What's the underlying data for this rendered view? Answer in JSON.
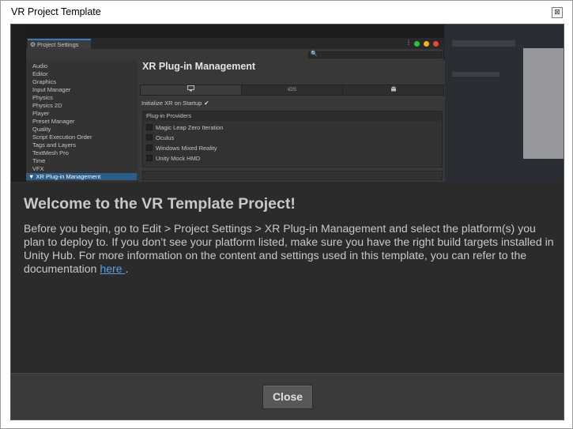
{
  "window": {
    "title": "VR Project Template",
    "close_glyph": "⊠"
  },
  "screenshot": {
    "settings_tab": "Project Settings",
    "sidebar_items": [
      "Audio",
      "Editor",
      "Graphics",
      "Input Manager",
      "Physics",
      "Physics 2D",
      "Player",
      "Preset Manager",
      "Quality",
      "Script Execution Order",
      "Tags and Layers",
      "TextMesh Pro",
      "Time",
      "VFX"
    ],
    "selected_item": "XR Plug-in Management",
    "selected_arrow": "▼",
    "heading": "XR Plug-in Management",
    "platform_tabs": [
      "",
      "iOS",
      ""
    ],
    "initialize_label": "Initialize XR on Startup",
    "initialize_check": "✔",
    "providers_header": "Plug-in Providers",
    "providers": [
      "Magic Leap Zero Iteration",
      "Oculus",
      "Windows Mixed Reality",
      "Unity Mock HMD"
    ]
  },
  "welcome": {
    "title": "Welcome to the VR Template Project!",
    "body": "Before you begin, go to Edit > Project Settings > XR Plug-in Management and select the platform(s) you plan to deploy to. If you don’t see your platform listed, make sure you have the right build targets installed in Unity Hub. For more information on the content and settings used in this template, you can refer to the documentation ",
    "link": "here ",
    "after_link": "."
  },
  "footer": {
    "close_label": "Close"
  }
}
